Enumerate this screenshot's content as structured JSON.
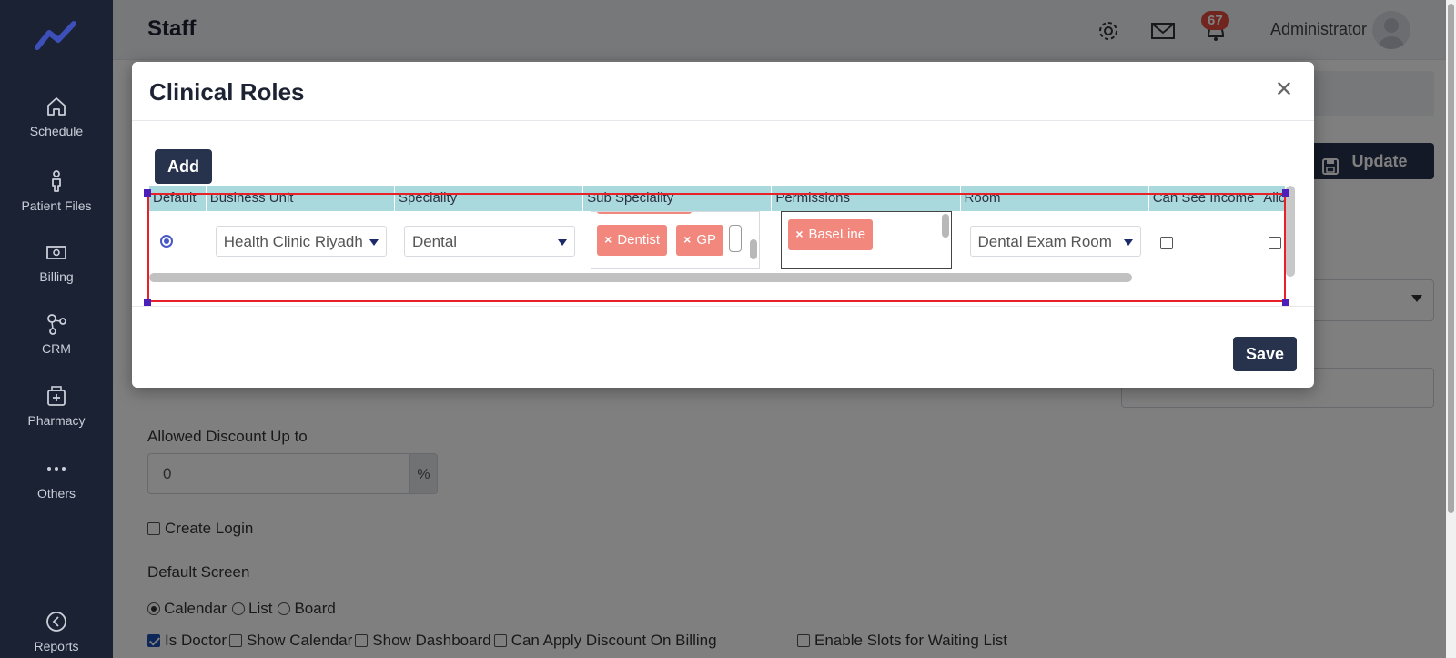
{
  "sidebar": {
    "items": [
      {
        "label": "Schedule",
        "icon": "home-icon"
      },
      {
        "label": "Patient Files",
        "icon": "person-icon"
      },
      {
        "label": "Billing",
        "icon": "money-icon"
      },
      {
        "label": "CRM",
        "icon": "crm-icon"
      },
      {
        "label": "Pharmacy",
        "icon": "pharmacy-icon"
      },
      {
        "label": "Others",
        "icon": "dots-icon"
      },
      {
        "label": "Reports",
        "icon": "reports-icon"
      }
    ]
  },
  "header": {
    "title": "Staff",
    "notifications_count": "67",
    "user_name": "Administrator"
  },
  "background": {
    "update_label": "Update",
    "discount_label": "Allowed Discount Up to",
    "discount_value": "0",
    "discount_suffix": "%",
    "create_login_label": "Create Login",
    "default_screen_label": "Default Screen",
    "screen_options": [
      "Calendar",
      "List",
      "Board"
    ],
    "checks": {
      "is_doctor": "Is Doctor",
      "show_calendar": "Show Calendar",
      "show_dashboard": "Show Dashboard",
      "can_apply_discount": "Can Apply Discount On Billing",
      "enable_slots": "Enable Slots for Waiting List"
    }
  },
  "modal": {
    "title": "Clinical Roles",
    "close_symbol": "×",
    "add_label": "Add",
    "save_label": "Save",
    "columns": [
      "Default",
      "Business Unit",
      "Speciality",
      "Sub Speciality",
      "Permissions",
      "Room",
      "Can See Income",
      "Allo"
    ],
    "row": {
      "business_unit": "Health Clinic Riyadh",
      "speciality": "Dental",
      "sub_speciality_tags": [
        "Dentist",
        "GP"
      ],
      "permission_tags": [
        "BaseLine"
      ],
      "room": "Dental Exam Room"
    }
  },
  "colors": {
    "sidebar_bg": "#1b2233",
    "primary_button": "#27324c",
    "grid_header": "#a9d9dc",
    "tag": "#f2877d",
    "badge": "#e04b3d",
    "selection": "#e8202a"
  }
}
